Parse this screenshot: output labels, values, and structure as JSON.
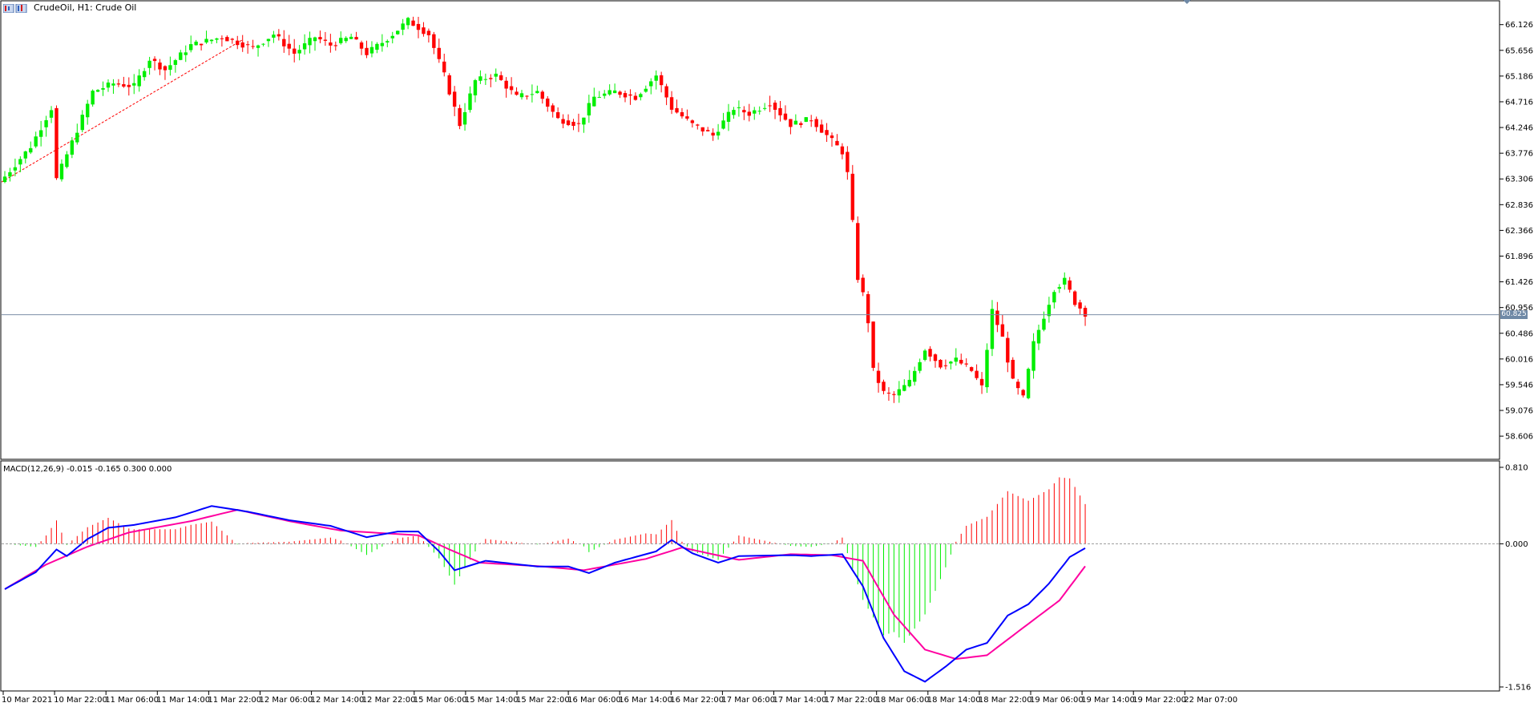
{
  "title": {
    "symbol": "CrudeOil",
    "timeframe": "H1",
    "description": "Crude Oil",
    "full_text": "CrudeOil, H1:  Crude Oil"
  },
  "macd_label": "MACD(12,26,9) -0.015 -0.165 0.300 0.000",
  "current_price_label": "60.825",
  "colors": {
    "bull": "#00ee00",
    "bear": "#ff0000",
    "macd_line": "#0000ff",
    "signal_line": "#ff00a0",
    "price_line": "#7b8ea7",
    "trendline": "#ff0000"
  },
  "chart_data": [
    {
      "type": "candlestick",
      "title": "CrudeOil, H1:  Crude Oil",
      "ylim": [
        58.3,
        66.4
      ],
      "y_ticks": [
        "66.126",
        "65.656",
        "65.186",
        "64.716",
        "64.246",
        "63.776",
        "63.306",
        "62.836",
        "62.366",
        "61.896",
        "61.426",
        "60.956",
        "60.486",
        "60.016",
        "59.546",
        "59.076",
        "58.606"
      ],
      "x_ticks": [
        "10 Mar 2021",
        "10 Mar 22:00",
        "11 Mar 06:00",
        "11 Mar 14:00",
        "11 Mar 22:00",
        "12 Mar 06:00",
        "12 Mar 14:00",
        "12 Mar 22:00",
        "15 Mar 06:00",
        "15 Mar 14:00",
        "15 Mar 22:00",
        "16 Mar 06:00",
        "16 Mar 14:00",
        "16 Mar 22:00",
        "17 Mar 06:00",
        "17 Mar 14:00",
        "17 Mar 22:00",
        "18 Mar 06:00",
        "18 Mar 14:00",
        "18 Mar 22:00",
        "19 Mar 06:00",
        "19 Mar 14:00",
        "19 Mar 22:00",
        "22 Mar 07:00"
      ],
      "current_price": 60.825,
      "anchors": [
        [
          0,
          63.35
        ],
        [
          5,
          63.9
        ],
        [
          9,
          64.6
        ],
        [
          10,
          63.3
        ],
        [
          14,
          64.2
        ],
        [
          17,
          64.9
        ],
        [
          21,
          65.05
        ],
        [
          25,
          65.0
        ],
        [
          28,
          65.5
        ],
        [
          31,
          65.3
        ],
        [
          36,
          65.75
        ],
        [
          42,
          65.9
        ],
        [
          48,
          65.7
        ],
        [
          52,
          65.95
        ],
        [
          56,
          65.6
        ],
        [
          60,
          65.9
        ],
        [
          63,
          65.75
        ],
        [
          67,
          65.9
        ],
        [
          70,
          65.6
        ],
        [
          73,
          65.8
        ],
        [
          75,
          65.95
        ],
        [
          78,
          66.2
        ],
        [
          82,
          65.95
        ],
        [
          85,
          65.2
        ],
        [
          88,
          64.3
        ],
        [
          91,
          65.1
        ],
        [
          95,
          65.2
        ],
        [
          99,
          64.8
        ],
        [
          103,
          64.9
        ],
        [
          107,
          64.4
        ],
        [
          111,
          64.3
        ],
        [
          114,
          64.8
        ],
        [
          118,
          64.9
        ],
        [
          122,
          64.8
        ],
        [
          126,
          65.2
        ],
        [
          129,
          64.6
        ],
        [
          133,
          64.3
        ],
        [
          137,
          64.1
        ],
        [
          141,
          64.6
        ],
        [
          144,
          64.5
        ],
        [
          148,
          64.7
        ],
        [
          152,
          64.3
        ],
        [
          156,
          64.4
        ],
        [
          159,
          64.1
        ],
        [
          162,
          63.8
        ],
        [
          163,
          63.4
        ],
        [
          164,
          62.5
        ],
        [
          165,
          61.5
        ],
        [
          166,
          61.2
        ],
        [
          167,
          60.7
        ],
        [
          168,
          59.8
        ],
        [
          170,
          59.4
        ],
        [
          172,
          59.35
        ],
        [
          175,
          59.6
        ],
        [
          178,
          60.2
        ],
        [
          181,
          59.9
        ],
        [
          184,
          60.0
        ],
        [
          187,
          59.8
        ],
        [
          189,
          59.5
        ],
        [
          191,
          60.9
        ],
        [
          193,
          60.4
        ],
        [
          195,
          59.6
        ],
        [
          197,
          59.3
        ],
        [
          199,
          60.3
        ],
        [
          201,
          60.8
        ],
        [
          203,
          61.3
        ],
        [
          205,
          61.45
        ],
        [
          207,
          61.05
        ],
        [
          208,
          60.95
        ],
        [
          209,
          60.85
        ]
      ]
    },
    {
      "type": "macd",
      "title": "MACD(12,26,9) -0.015 -0.165 0.300 0.000",
      "ylim": [
        -1.516,
        0.81
      ],
      "y_ticks": [
        "0.810",
        "0.000",
        "-1.516"
      ],
      "macd_anchors": [
        [
          0,
          -0.48
        ],
        [
          6,
          -0.3
        ],
        [
          10,
          -0.06
        ],
        [
          12,
          -0.13
        ],
        [
          16,
          0.05
        ],
        [
          20,
          0.17
        ],
        [
          25,
          0.2
        ],
        [
          33,
          0.28
        ],
        [
          40,
          0.4
        ],
        [
          47,
          0.34
        ],
        [
          55,
          0.25
        ],
        [
          63,
          0.19
        ],
        [
          70,
          0.07
        ],
        [
          76,
          0.13
        ],
        [
          80,
          0.13
        ],
        [
          84,
          -0.08
        ],
        [
          87,
          -0.28
        ],
        [
          93,
          -0.18
        ],
        [
          103,
          -0.24
        ],
        [
          109,
          -0.24
        ],
        [
          113,
          -0.31
        ],
        [
          118,
          -0.2
        ],
        [
          126,
          -0.08
        ],
        [
          129,
          0.04
        ],
        [
          133,
          -0.1
        ],
        [
          138,
          -0.2
        ],
        [
          142,
          -0.13
        ],
        [
          152,
          -0.12
        ],
        [
          156,
          -0.13
        ],
        [
          162,
          -0.11
        ],
        [
          166,
          -0.45
        ],
        [
          170,
          -1.0
        ],
        [
          174,
          -1.35
        ],
        [
          178,
          -1.46
        ],
        [
          182,
          -1.3
        ],
        [
          186,
          -1.12
        ],
        [
          190,
          -1.05
        ],
        [
          194,
          -0.76
        ],
        [
          198,
          -0.64
        ],
        [
          202,
          -0.42
        ],
        [
          206,
          -0.14
        ],
        [
          210,
          -0.015
        ]
      ],
      "signal_anchors": [
        [
          0,
          -0.48
        ],
        [
          8,
          -0.22
        ],
        [
          16,
          -0.03
        ],
        [
          24,
          0.12
        ],
        [
          36,
          0.24
        ],
        [
          45,
          0.36
        ],
        [
          55,
          0.24
        ],
        [
          65,
          0.14
        ],
        [
          80,
          0.09
        ],
        [
          86,
          -0.06
        ],
        [
          92,
          -0.2
        ],
        [
          104,
          -0.24
        ],
        [
          112,
          -0.28
        ],
        [
          124,
          -0.16
        ],
        [
          131,
          -0.04
        ],
        [
          142,
          -0.17
        ],
        [
          152,
          -0.11
        ],
        [
          160,
          -0.12
        ],
        [
          166,
          -0.18
        ],
        [
          172,
          -0.75
        ],
        [
          178,
          -1.12
        ],
        [
          184,
          -1.22
        ],
        [
          190,
          -1.18
        ],
        [
          196,
          -0.93
        ],
        [
          204,
          -0.6
        ],
        [
          210,
          -0.165
        ]
      ]
    }
  ]
}
